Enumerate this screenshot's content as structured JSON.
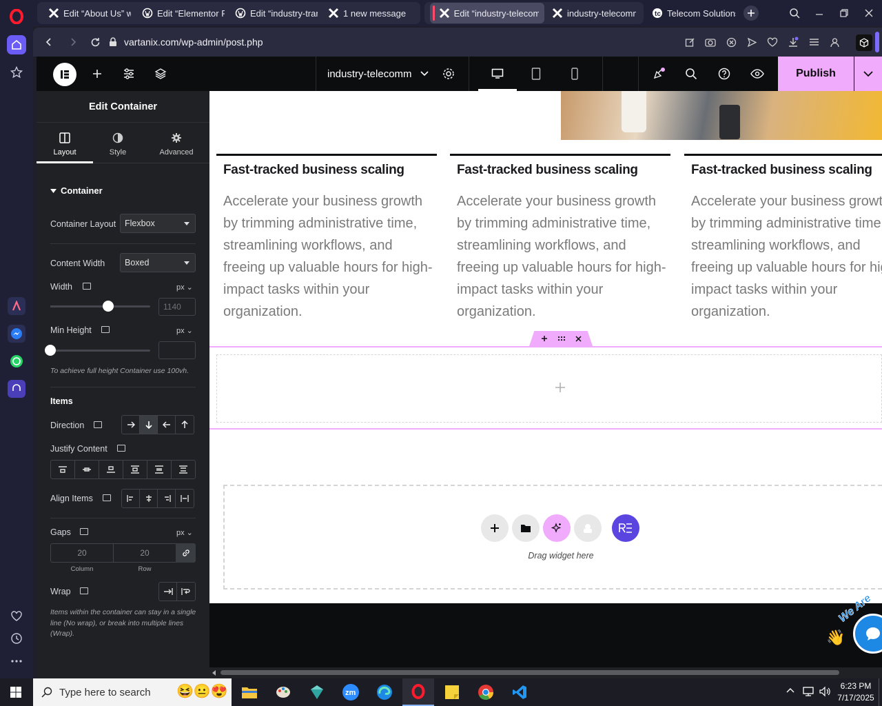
{
  "browser": {
    "tabs": [
      {
        "title": "Edit “About Us” wit",
        "icon": "elementor-x-icon"
      },
      {
        "title": "Edit “Elementor Pag",
        "icon": "wordpress-icon"
      },
      {
        "title": "Edit “industry-transp",
        "icon": "wordpress-icon"
      },
      {
        "title": "1 new message",
        "icon": "elementor-x-icon"
      },
      {
        "title": "Edit “industry-telecomm”",
        "icon": "elementor-x-icon"
      },
      {
        "title": "industry-telecomm",
        "icon": "elementor-x-icon"
      },
      {
        "title": "Telecom Solutions -",
        "icon": "site-logo-icon"
      }
    ],
    "url": "vartanix.com/wp-admin/post.php"
  },
  "editor": {
    "page_name": "industry-telecomm",
    "publish_label": "Publish"
  },
  "panel": {
    "title": "Edit Container",
    "tabs": [
      "Layout",
      "Style",
      "Advanced"
    ],
    "section": "Container",
    "container_layout_label": "Container Layout",
    "container_layout_value": "Flexbox",
    "content_width_label": "Content Width",
    "content_width_value": "Boxed",
    "width_label": "Width",
    "width_unit": "px",
    "width_placeholder": "1140",
    "width_slider_fraction": 0.58,
    "min_height_label": "Min Height",
    "min_height_unit": "px",
    "min_height_hint": "To achieve full height Container use 100vh.",
    "items_heading": "Items",
    "direction_label": "Direction",
    "justify_label": "Justify Content",
    "align_label": "Align Items",
    "gaps_label": "Gaps",
    "gaps_unit": "px",
    "gap_column": "20",
    "gap_row": "20",
    "gap_column_label": "Column",
    "gap_row_label": "Row",
    "wrap_label": "Wrap",
    "wrap_hint": "Items within the container can stay in a single line (No wrap), or break into multiple lines (Wrap)."
  },
  "canvas": {
    "columns": [
      {
        "heading": "Fast-tracked business scaling",
        "body": "Accelerate your business growth by trimming administrative time, streamlining workflows, and freeing up valuable hours for high-impact tasks within your organization."
      },
      {
        "heading": "Fast-tracked business scaling",
        "body": "Accelerate your business growth by trimming administrative time, streamlining workflows, and freeing up valuable hours for high-impact tasks within your organization."
      },
      {
        "heading": "Fast-tracked business scaling",
        "body": "Accelerate your business growth by trimming administrative time, streamlining workflows, and freeing up valuable hours for high-impact tasks within your organization."
      }
    ],
    "drag_widget_label": "Drag widget here",
    "chat_badge": "We Are"
  },
  "taskbar": {
    "search_placeholder": "Type here to search",
    "time": "6:23 PM",
    "date": "7/17/2025"
  },
  "colors": {
    "accent": "#f0abfc",
    "panel_bg": "#1f2124",
    "topbar_bg": "#0c0d0e",
    "chat_blue": "#1e88e5"
  }
}
